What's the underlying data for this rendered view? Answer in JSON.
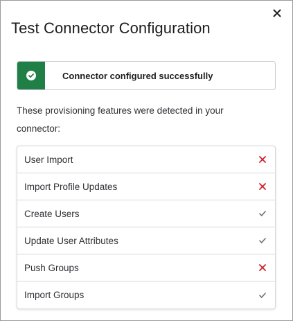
{
  "dialog": {
    "title": "Test Connector Configuration",
    "close_icon": "close-icon"
  },
  "banner": {
    "icon": "check-circle-icon",
    "message": "Connector configured successfully",
    "color": "#1f7f47"
  },
  "intro": "These provisioning features were detected in your connector:",
  "features": [
    {
      "label": "User Import",
      "status": "unsupported",
      "icon": "x-icon"
    },
    {
      "label": "Import Profile Updates",
      "status": "unsupported",
      "icon": "x-icon"
    },
    {
      "label": "Create Users",
      "status": "supported",
      "icon": "check-icon"
    },
    {
      "label": "Update User Attributes",
      "status": "supported",
      "icon": "check-icon"
    },
    {
      "label": "Push Groups",
      "status": "unsupported",
      "icon": "x-icon"
    },
    {
      "label": "Import Groups",
      "status": "supported",
      "icon": "check-icon"
    }
  ],
  "colors": {
    "unsupported": "#d0212a",
    "supported": "#6e6e78"
  }
}
